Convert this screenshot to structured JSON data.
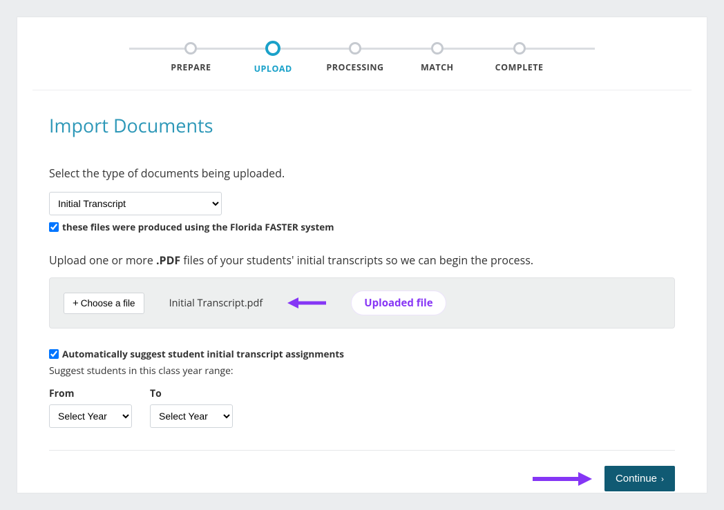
{
  "stepper": {
    "steps": [
      {
        "label": "PREPARE"
      },
      {
        "label": "UPLOAD"
      },
      {
        "label": "PROCESSING"
      },
      {
        "label": "MATCH"
      },
      {
        "label": "COMPLETE"
      }
    ],
    "active_index": 1
  },
  "title": "Import Documents",
  "doc_type_prompt": "Select the type of documents being uploaded.",
  "doc_type_selected": "Initial Transcript",
  "faster_checkbox": {
    "checked": true,
    "label": "these files were produced using the Florida FASTER system"
  },
  "upload_prompt_prefix": "Upload one or more ",
  "upload_prompt_bold": ".PDF",
  "upload_prompt_suffix": " files of your students' initial transcripts so we can begin the process.",
  "choose_file_label": "Choose a file",
  "uploaded_filename": "Initial Transcript.pdf",
  "annotation_badge": "Uploaded file",
  "auto_suggest_checkbox": {
    "checked": true,
    "label": "Automatically suggest student initial transcript assignments"
  },
  "year_range_hint": "Suggest students in this class year range:",
  "year_from_label": "From",
  "year_to_label": "To",
  "year_placeholder": "Select Year",
  "continue_label": "Continue"
}
